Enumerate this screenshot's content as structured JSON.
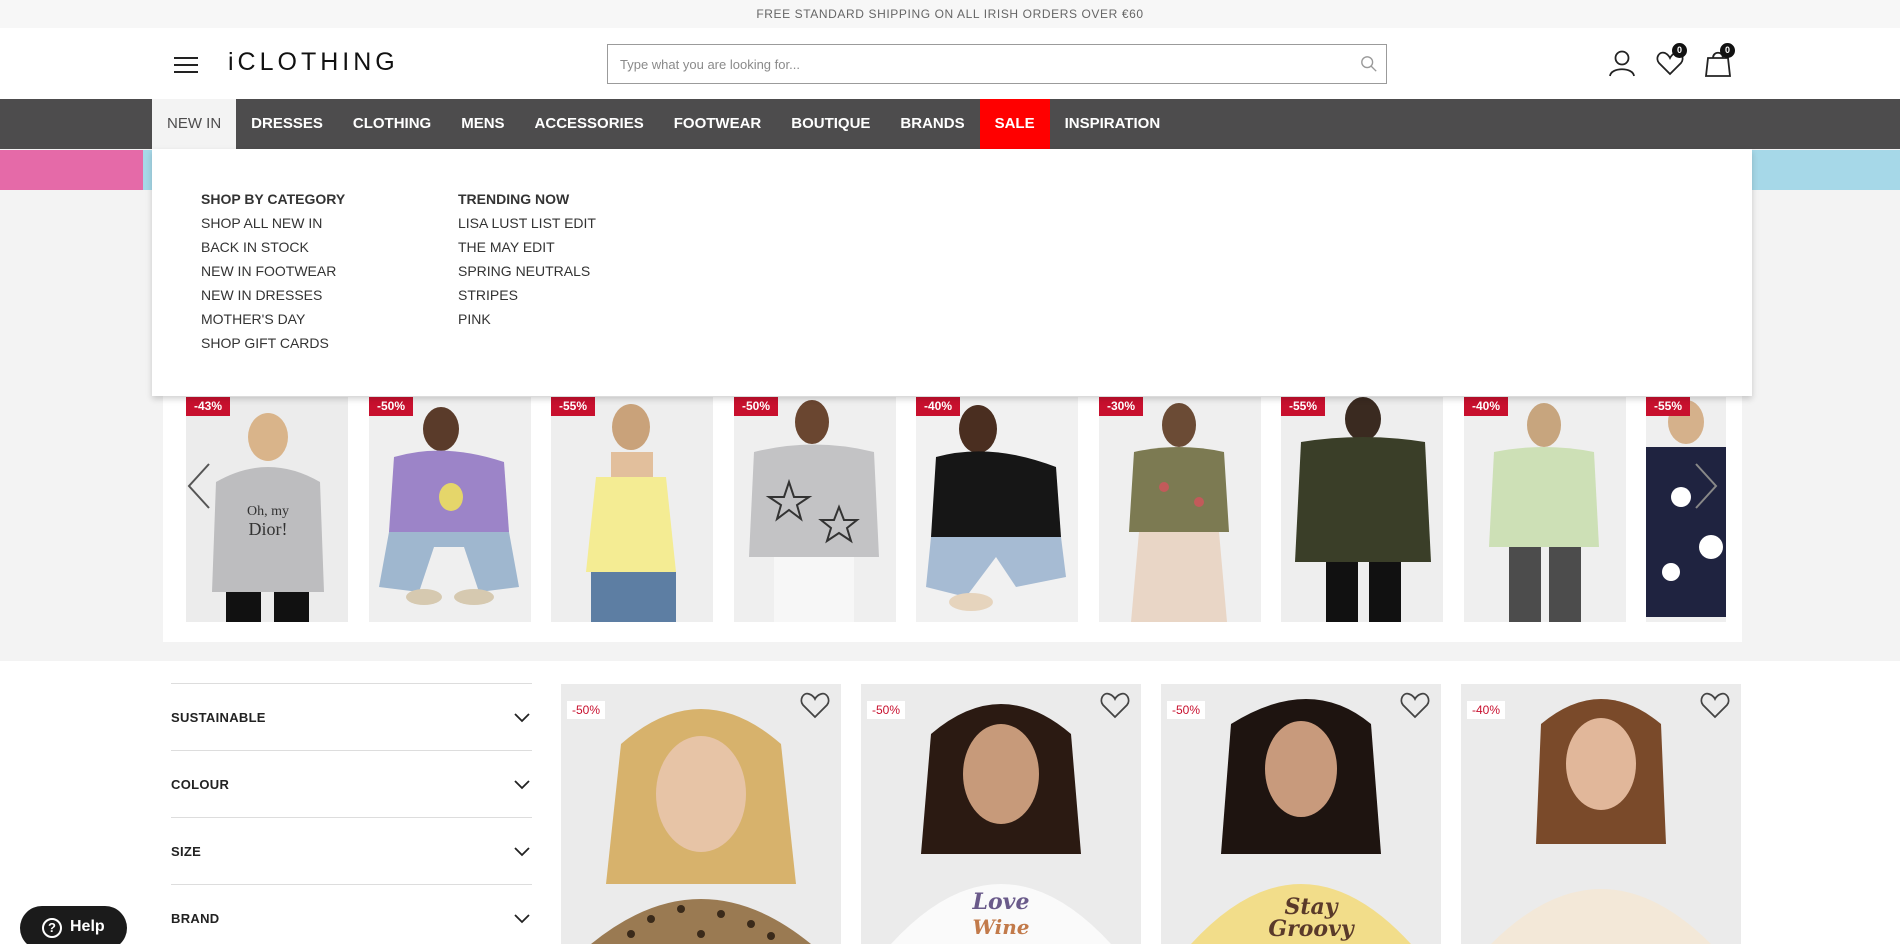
{
  "promo": {
    "text": "FREE STANDARD SHIPPING ON ALL IRISH ORDERS OVER €60"
  },
  "header": {
    "logo": "iCLOTHING",
    "search_placeholder": "Type what you are looking for...",
    "wishlist_count": "0",
    "bag_count": "0"
  },
  "nav": {
    "items": [
      "NEW IN",
      "DRESSES",
      "CLOTHING",
      "MENS",
      "ACCESSORIES",
      "FOOTWEAR",
      "BOUTIQUE",
      "BRANDS",
      "SALE",
      "INSPIRATION"
    ],
    "active": "NEW IN",
    "sale_color": "#ff0000"
  },
  "mega_menu": {
    "columns": [
      {
        "heading": "SHOP BY CATEGORY",
        "links": [
          "SHOP ALL NEW IN",
          "BACK IN STOCK",
          "NEW IN FOOTWEAR",
          "NEW IN DRESSES",
          "MOTHER'S DAY",
          "SHOP GIFT CARDS"
        ]
      },
      {
        "heading": "TRENDING NOW",
        "links": [
          "LISA LUST LIST EDIT",
          "THE MAY EDIT",
          "SPRING NEUTRALS",
          "STRIPES",
          "PINK"
        ]
      }
    ]
  },
  "carousel": {
    "badges": [
      "-43%",
      "-50%",
      "-55%",
      "-50%",
      "-40%",
      "-30%",
      "-55%",
      "-40%",
      "-55%"
    ],
    "badge_color": "#c8102e"
  },
  "filters": {
    "items": [
      "SUSTAINABLE",
      "COLOUR",
      "SIZE",
      "BRAND"
    ]
  },
  "products": {
    "badges": [
      "-50%",
      "-50%",
      "-50%",
      "-40%"
    ]
  },
  "help": {
    "label": "Help"
  }
}
